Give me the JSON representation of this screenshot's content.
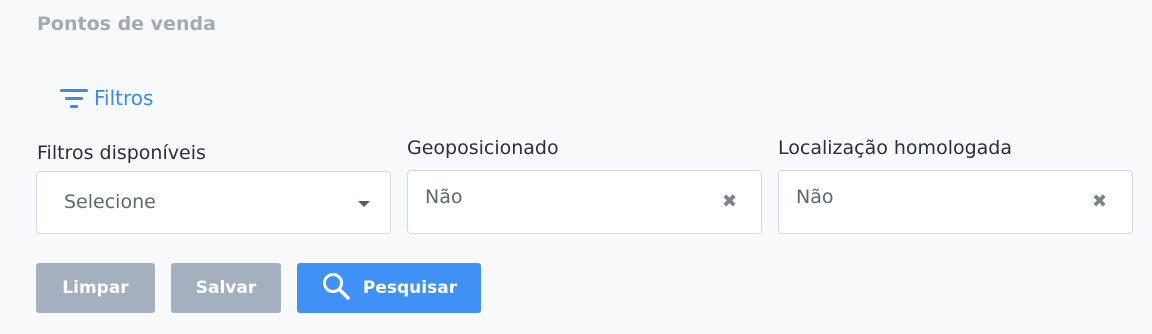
{
  "page": {
    "title": "Pontos de venda"
  },
  "filters_toggle": {
    "icon": "filter-icon",
    "label": "Filtros",
    "color": "#3f8ae8"
  },
  "fields": {
    "available": {
      "label": "Filtros disponíveis",
      "placeholder": "Selecione",
      "icon": "chevron-down-icon"
    },
    "geo": {
      "label": "Geoposicionado",
      "value": "Não",
      "icon": "clear-icon"
    },
    "homolog": {
      "label": "Localização homologada",
      "value": "Não",
      "icon": "clear-icon"
    }
  },
  "buttons": {
    "clear": "Limpar",
    "save": "Salvar",
    "search": {
      "label": "Pesquisar",
      "icon": "search-icon",
      "color": "#3f91f5"
    }
  }
}
